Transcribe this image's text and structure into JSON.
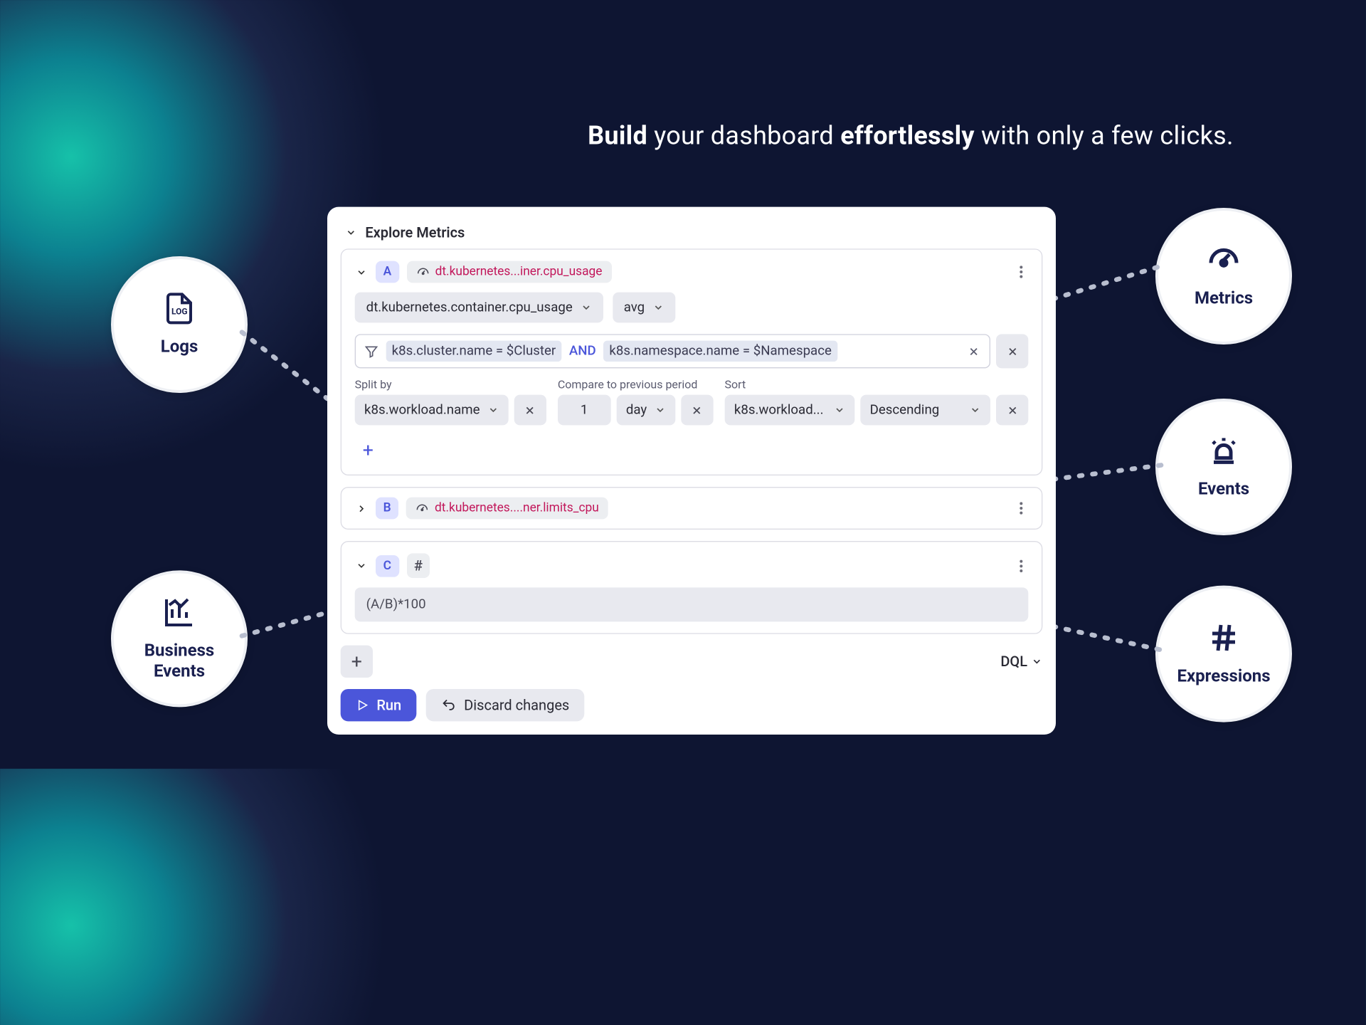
{
  "headline": {
    "b1": "Build",
    "t1": " your dashboard ",
    "b2": "effortlessly",
    "t2": " with only a few clicks."
  },
  "panel": {
    "title": "Explore Metrics"
  },
  "queryA": {
    "badge": "A",
    "chip_metric": "dt.kubernetes...iner.cpu_usage",
    "metric_full": "dt.kubernetes.container.cpu_usage",
    "agg": "avg",
    "filter1": "k8s.cluster.name = $Cluster",
    "and": "AND",
    "filter2": "k8s.namespace.name = $Namespace",
    "split_label": "Split by",
    "split_value": "k8s.workload.name",
    "compare_label": "Compare to previous period",
    "compare_num": "1",
    "compare_unit": "day",
    "sort_label": "Sort",
    "sort_field": "k8s.workload...",
    "sort_dir": "Descending"
  },
  "queryB": {
    "badge": "B",
    "chip_metric": "dt.kubernetes....ner.limits_cpu"
  },
  "queryC": {
    "badge": "C",
    "hash": "#",
    "expression": "(A/B)*100"
  },
  "actions": {
    "dql": "DQL",
    "run": "Run",
    "discard": "Discard changes"
  },
  "bubbles": {
    "logs": "Logs",
    "metrics": "Metrics",
    "events": "Events",
    "expressions": "Expressions",
    "business": "Business\nEvents"
  }
}
